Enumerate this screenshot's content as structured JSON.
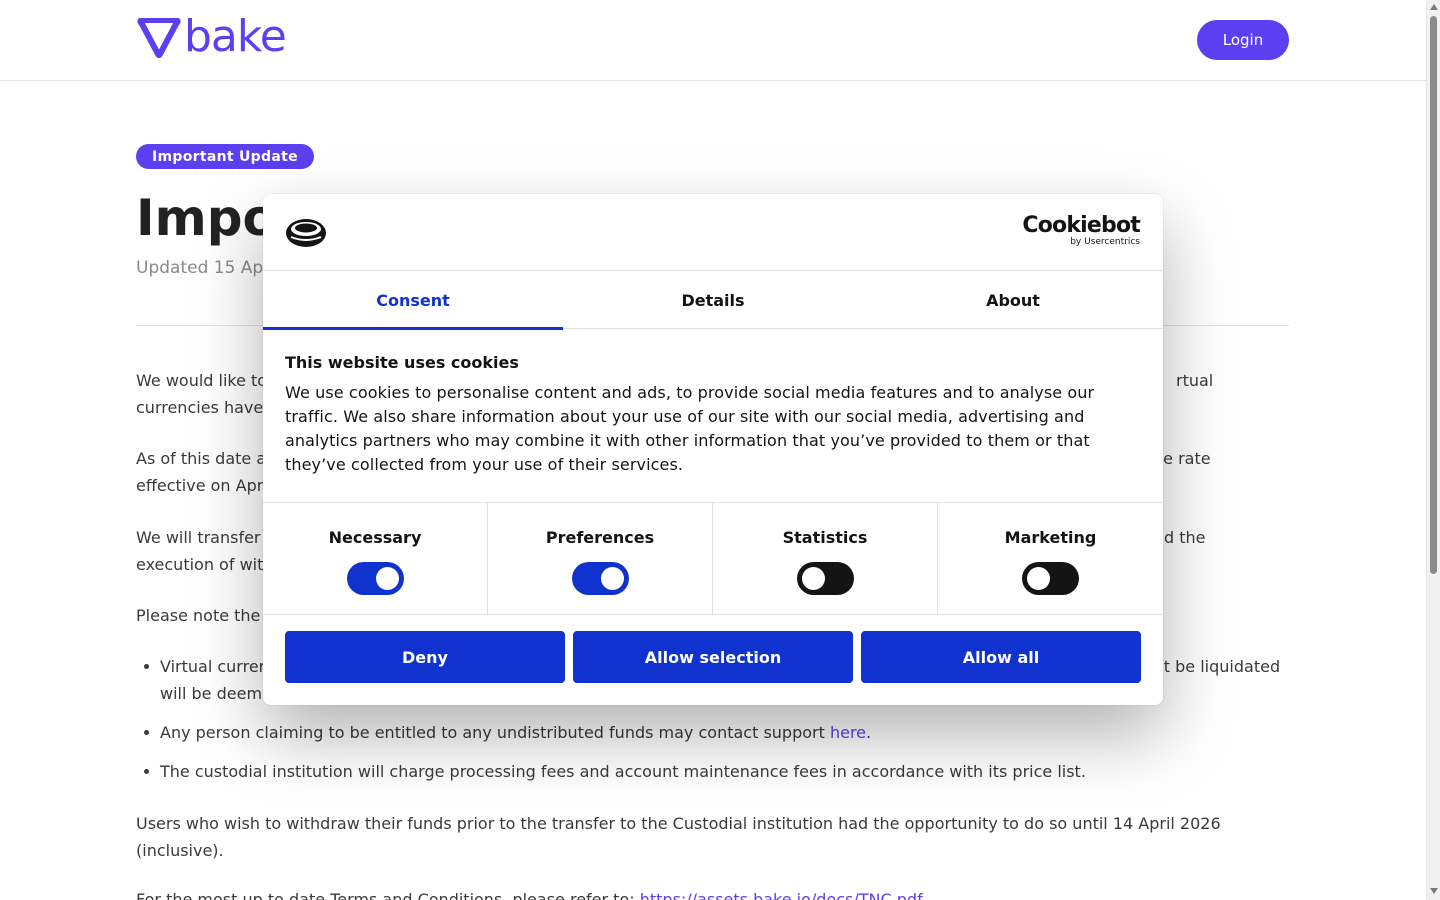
{
  "header": {
    "logo_text": "bake",
    "login_label": "Login"
  },
  "article": {
    "badge": "Important Update",
    "title": "Impo",
    "updated": "Updated 15 Ap",
    "paragraphs": {
      "p1_line1_left": "We would like to",
      "p1_line1_right": "rtual",
      "p1_line2_left": "currencies have",
      "p2_line1_left": "As of this date a",
      "p2_line1_right": "ge rate",
      "p2_line2_left": "effective on Apr",
      "p3_line1_left": "We will transfer",
      "p3_line1_right": "d the",
      "p3_line2_left": "execution of wit",
      "p4_left": "Please note the"
    },
    "bullets": {
      "b1_line1_left": "Virtual curren",
      "b1_line1_right": "ot be liquidated",
      "b1_line2_left": "will be deem",
      "b2_text": "Any person claiming to be entitled to any undistributed funds may contact support ",
      "b2_link": "here",
      "b2_end": ".",
      "b3_text": "The custodial institution will charge processing fees and account maintenance fees in accordance with its price list."
    },
    "p5": "Users who wish to withdraw their funds prior to the transfer to the Custodial institution had the opportunity to do so until 14 April 2026 (inclusive).",
    "p6_text": "For the most up to date Terms and Conditions, please refer to: ",
    "p6_link": "https://assets.bake.io/docs/TNC.pdf"
  },
  "cookie_dialog": {
    "brand_name": "Cookiebot",
    "brand_sub": "by Usercentrics",
    "tabs": [
      "Consent",
      "Details",
      "About"
    ],
    "active_tab": "Consent",
    "title": "This website uses cookies",
    "text": "We use cookies to personalise content and ads, to provide social media features and to analyse our traffic. We also share information about your use of our site with our social media, advertising and analytics partners who may combine it with other information that you’ve provided to them or that they’ve collected from your use of their services.",
    "toggles": [
      {
        "label": "Necessary",
        "state": "on"
      },
      {
        "label": "Preferences",
        "state": "on"
      },
      {
        "label": "Statistics",
        "state": "off"
      },
      {
        "label": "Marketing",
        "state": "off"
      }
    ],
    "buttons": {
      "deny": "Deny",
      "allow_selection": "Allow selection",
      "allow_all": "Allow all"
    }
  },
  "colors": {
    "brand_purple": "#5b3ff0",
    "cookie_blue": "#1032cf",
    "toggle_off": "#141414"
  }
}
